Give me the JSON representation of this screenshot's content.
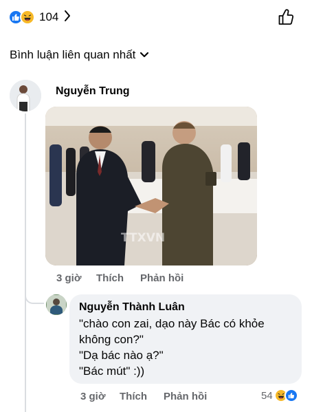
{
  "reactions": {
    "count": "104",
    "icons": [
      "like-icon",
      "haha-icon"
    ]
  },
  "sort_label": "Bình luận liên quan nhất",
  "comment": {
    "author": "Nguyễn Trung",
    "photo_watermark": "TTXVN",
    "time": "3 giờ",
    "like_label": "Thích",
    "reply_label": "Phản hồi"
  },
  "reply": {
    "author": "Nguyễn Thành Luân",
    "lines": [
      "\"chào con zai, dạo này Bác có khỏe không con?\"",
      "\"Dạ bác nào ạ?\"",
      "\"Bác mút\" :))"
    ],
    "time": "3 giờ",
    "like_label": "Thích",
    "reply_label": "Phản hồi",
    "reaction_count": "54"
  },
  "colors": {
    "accent": "#1877f2",
    "secondary_text": "#65676b",
    "bubble": "#f0f2f5"
  }
}
